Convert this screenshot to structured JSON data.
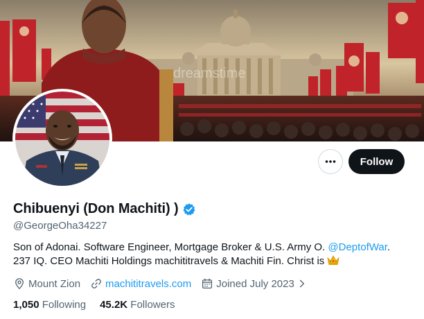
{
  "banner": {
    "watermark": "dreamstime"
  },
  "profile": {
    "display_name": "Chibuenyi (Don Machiti) )",
    "handle": "@GeorgeOha34227",
    "bio_line1_text": "Son of Adonai. Software Engineer, Mortgage Broker & U.S. Army O. ",
    "bio_mention": "@DeptofWar",
    "bio_line1_end": ".",
    "bio_line2_text": "237 IQ. CEO Machiti Holdings machititravels & Machiti Fin. Christ is ",
    "location": "Mount Zion",
    "website": "machititravels.com",
    "joined": "Joined July 2023"
  },
  "actions": {
    "follow_label": "Follow"
  },
  "stats": {
    "following_count": "1,050",
    "following_label": "Following",
    "followers_count": "45.2K",
    "followers_label": "Followers"
  },
  "icons": [
    "more-icon",
    "verified-icon",
    "crown-emoji-icon",
    "location-icon",
    "link-icon",
    "calendar-icon",
    "chevron-right-icon"
  ],
  "colors": {
    "accent": "#1d9bf0",
    "text": "#0f1419",
    "secondary": "#536471",
    "follow_bg": "#0f1419"
  }
}
